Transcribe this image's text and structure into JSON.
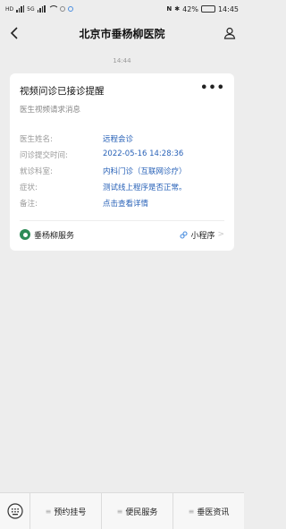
{
  "status_bar": {
    "signal_labels": [
      "HD",
      "5G"
    ],
    "battery": "42%",
    "time": "14:45"
  },
  "nav": {
    "title": "北京市垂杨柳医院"
  },
  "chat": {
    "timestamp": "14:44"
  },
  "card": {
    "title": "视频问诊已接诊提醒",
    "more": "•••",
    "subtitle": "医生视频请求消息",
    "fields": [
      {
        "label": "医生姓名:",
        "value": "远程会诊"
      },
      {
        "label": "问诊提交时间:",
        "value": "2022-05-16 14:28:36"
      },
      {
        "label": "就诊科室:",
        "value": "内科门诊（互联网诊疗）"
      },
      {
        "label": "症状:",
        "value": "测试线上程序是否正常。"
      },
      {
        "label": "备注:",
        "value": "点击查看详情"
      }
    ],
    "footer": {
      "service_name": "垂杨柳服务",
      "mini_program": "小程序",
      "arrow": ">"
    }
  },
  "bottom_menu": {
    "items": [
      {
        "label": "预约挂号"
      },
      {
        "label": "便民服务"
      },
      {
        "label": "垂医资讯"
      }
    ]
  },
  "colors": {
    "link": "#2a63b8",
    "background": "#ededed"
  }
}
